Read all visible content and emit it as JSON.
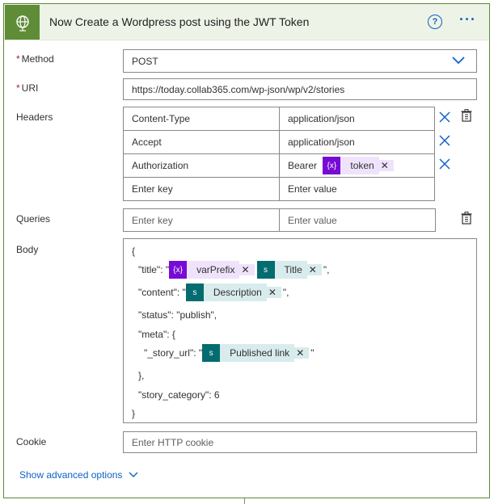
{
  "header": {
    "title": "Now Create a Wordpress post using the JWT Token",
    "icon": "globe-icon",
    "accent": "#5f8c37"
  },
  "method": {
    "label": "Method",
    "required_mark": "*",
    "value": "POST"
  },
  "uri": {
    "label": "URI",
    "required_mark": "*",
    "value": "https://today.collab365.com/wp-json/wp/v2/stories"
  },
  "headers": {
    "label": "Headers",
    "rows": [
      {
        "key": "Content-Type",
        "value": "application/json"
      },
      {
        "key": "Accept",
        "value": "application/json"
      },
      {
        "key": "Authorization",
        "value_prefix": "Bearer",
        "value_token": "token"
      }
    ],
    "key_placeholder": "Enter key",
    "value_placeholder": "Enter value"
  },
  "queries": {
    "label": "Queries",
    "key_placeholder": "Enter key",
    "value_placeholder": "Enter value"
  },
  "body": {
    "label": "Body",
    "open_brace": "{",
    "title_key": "\"title\": \"",
    "title_token_1": "varPrefix",
    "title_token_2": "Title",
    "title_end": "\",",
    "content_key": "\"content\": \"",
    "content_token": "Description",
    "content_end": "\",",
    "status_line": "\"status\": \"publish\",",
    "meta_line": "\"meta\": {",
    "story_url_key": "\"_story_url\": \"",
    "story_url_token": "Published link",
    "story_url_end": "\"",
    "meta_close": "},",
    "category_line": "\"story_category\": 6",
    "close_brace": "}"
  },
  "cookie": {
    "label": "Cookie",
    "placeholder": "Enter HTTP cookie"
  },
  "advanced": {
    "label": "Show advanced options"
  },
  "token_glyphs": {
    "variable": "{x}",
    "sharepoint": "s"
  }
}
